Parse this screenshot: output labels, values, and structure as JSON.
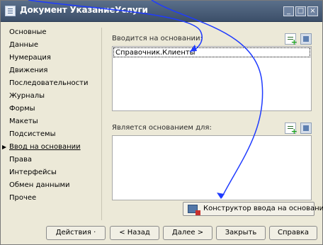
{
  "window": {
    "title": "Документ УказаниеУслуги",
    "controls": {
      "minimize": "_",
      "maximize": "□",
      "close": "×"
    }
  },
  "nav": {
    "items": [
      {
        "label": "Основные"
      },
      {
        "label": "Данные"
      },
      {
        "label": "Нумерация"
      },
      {
        "label": "Движения"
      },
      {
        "label": "Последовательности"
      },
      {
        "label": "Журналы"
      },
      {
        "label": "Формы"
      },
      {
        "label": "Макеты"
      },
      {
        "label": "Подсистемы"
      },
      {
        "label": "Ввод на основании",
        "active": true
      },
      {
        "label": "Права"
      },
      {
        "label": "Интерфейсы"
      },
      {
        "label": "Обмен данными"
      },
      {
        "label": "Прочее"
      }
    ]
  },
  "content": {
    "based_on": {
      "label": "Вводится на основании:",
      "items": [
        {
          "label": "Справочник.Клиенты"
        }
      ]
    },
    "is_basis_for": {
      "label": "Является основанием для:",
      "items": []
    },
    "constructor_button": {
      "label": "Конструктор ввода на основании",
      "icon": "constructor-icon"
    }
  },
  "footer": {
    "actions_label": "Действия",
    "actions_dots": "·",
    "back_label": "< Назад",
    "next_label": "Далее >",
    "close_label": "Закрыть",
    "help_label": "Справка"
  },
  "colors": {
    "titlebar": "#3c4f69",
    "window_bg": "#ece9d8",
    "annotation_arrow": "#1f3bff"
  }
}
